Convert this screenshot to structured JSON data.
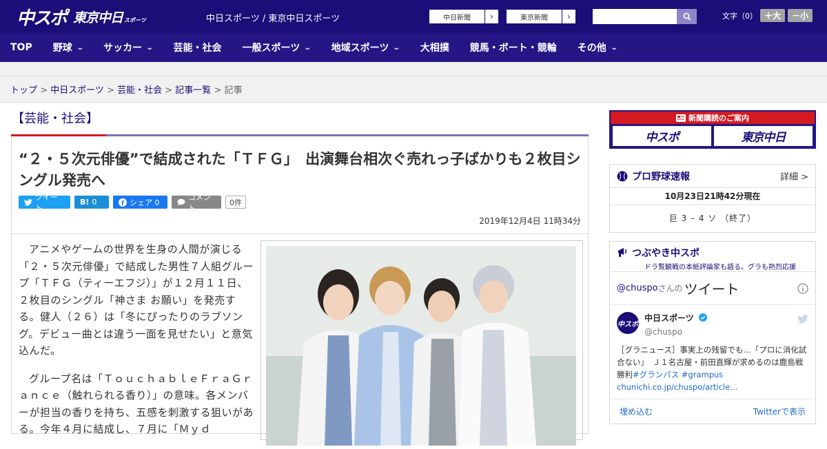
{
  "header": {
    "logo_main": "中スポ",
    "logo_sub": "東京中日",
    "logo_sub_small": "スポーツ",
    "caption": "中日スポーツ / 東京中日スポーツ",
    "ext_links": [
      "中日新聞",
      "東京新聞"
    ],
    "search_placeholder": "",
    "fontsize_label": "文字（0）",
    "fontsize_up": "＋大",
    "fontsize_down": "－小"
  },
  "nav": [
    {
      "label": "TOP",
      "caret": false
    },
    {
      "label": "野球",
      "caret": true
    },
    {
      "label": "サッカー",
      "caret": true
    },
    {
      "label": "芸能・社会",
      "caret": false
    },
    {
      "label": "一般スポーツ",
      "caret": true
    },
    {
      "label": "地域スポーツ",
      "caret": true
    },
    {
      "label": "大相撲",
      "caret": false
    },
    {
      "label": "競馬・ボート・競輪",
      "caret": false
    },
    {
      "label": "その他",
      "caret": true
    }
  ],
  "breadcrumb": {
    "items": [
      "トップ",
      "中日スポーツ",
      "芸能・社会",
      "記事一覧"
    ],
    "current": "記事",
    "sep": " > "
  },
  "article": {
    "category": "【芸能・社会】",
    "headline": "“２・５次元俳優”で結成された「ＴＦＧ」　出演舞台相次ぐ売れっ子ばかりも２枚目シングル発売へ",
    "share": {
      "tweet": "ツイート",
      "hatena_count": "0",
      "facebook": "シェア 0",
      "comment": "コメント",
      "comment_count": "0件"
    },
    "date": "2019年12月4日 11時34分",
    "paragraphs": [
      "アニメやゲームの世界を生身の人間が演じる「２・５次元俳優」で結成した男性７人組グループ「ＴＦＧ（ティーエフジ）」が１２月１１日、２枚目のシングル「神さま お願い」を発売する。健人（２６）は「冬にぴったりのラブソング。デビュー曲とは違う一面を見せたい」と意気込んだ。",
      "グループ名は「ＴｏｕｃｈａｂｌｅＦｒａＧｒａｎｃｅ（触れられる香り）」の意味。各メンバーが担当の香りを持ち、五感を刺激する狙いがある。今年４月に結成し、７月に「Ｍｙｄ"
    ]
  },
  "sidebar": {
    "banner_title": "新聞購読のご案内",
    "banner_btns": [
      "中スポ",
      "東京中日"
    ],
    "pro": {
      "title": "プロ野球速報",
      "detail": "詳細 >",
      "time": "10月23日21時42分現在",
      "score": "巨 3 – 4 ソ （終了）"
    },
    "tweets": {
      "title": "つぶやき中スポ",
      "subtitle": "ドラ覧観戦の本紙評論家も語る。グラも熱烈応援",
      "embed_prefix": "@chuspo",
      "embed_mid": "さんの",
      "embed_big": "ツイート",
      "user_name": "中日スポーツ",
      "user_handle": "@chuspo",
      "avatar_text": "中スポ",
      "tweet_text": "［グラニュース］事実上の残留でも…「プロに消化試合ない」　Ｊ１名古屋・前田直輝が求めるのは鹿島戦勝利",
      "tweet_tags": "#グランパス #grampus",
      "tweet_link": "chunichi.co.jp/chuspo/article…",
      "embed_label": "埋め込む",
      "view_label": "Twitterで表示"
    }
  },
  "colors": {
    "brand": "#1a0e78",
    "nav": "#241685",
    "accent_red": "#d51a22"
  }
}
